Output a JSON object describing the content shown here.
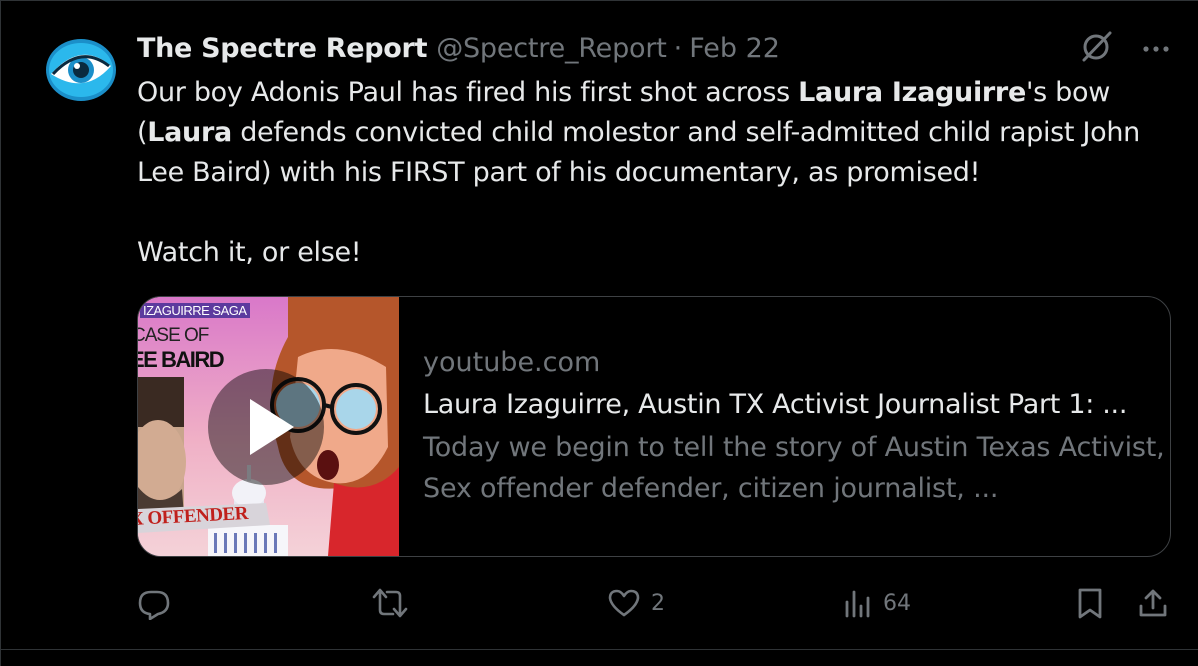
{
  "tweet": {
    "author": {
      "display_name": "The Spectre Report",
      "handle": "@Spectre_Report",
      "separator": "·",
      "date": "Feb 22",
      "avatar_icon": "eye-logo-icon"
    },
    "text": {
      "p1": {
        "s1": "Our boy Adonis Paul has fired his first shot across ",
        "b1": "Laura Izaguirre",
        "s2": "'s bow (",
        "b2": "Laura",
        "s3": " defends convicted child molestor and self-admitted child rapist John Lee Baird) with his FIRST part of his documentary, as promised!"
      },
      "p2": "Watch it, or else!"
    },
    "card": {
      "domain": "youtube.com",
      "title": "Laura Izaguirre, Austin TX Activist Journalist Part 1: ...",
      "description": "Today we begin to tell the story of Austin Texas Activist, Sex offender defender, citizen journalist, ...",
      "thumbnail": {
        "line1": "IZAGUIRRE SAGA",
        "line2": "CASE OF",
        "line3": "EE BAIRD",
        "banner": "X OFFENDER",
        "play_icon": "play-icon"
      }
    },
    "metrics": {
      "replies": "",
      "reposts": "",
      "likes": "2",
      "views": "64"
    },
    "icons": {
      "grok": "grok-slash-circle-icon",
      "more": "more-dots-icon",
      "reply": "reply-icon",
      "repost": "repost-icon",
      "like": "heart-icon",
      "views": "views-bar-chart-icon",
      "bookmark": "bookmark-icon",
      "share": "share-icon"
    },
    "colors": {
      "background": "#000000",
      "text": "#e7e9ea",
      "secondary": "#71767b",
      "border": "#2f3336",
      "avatar_cyan": "#29b6e8"
    }
  }
}
